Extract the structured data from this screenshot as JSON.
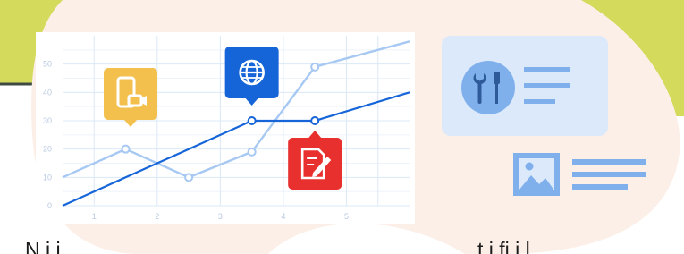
{
  "colors": {
    "bg_green": "#d4da5b",
    "bg_line": "#3f4b42",
    "blob_pink": "#fcefe8",
    "line_dark": "#1565d8",
    "line_light": "#a6c8f2",
    "grid": "#dce8f7",
    "icon_yellow": "#f3c04d",
    "icon_blue": "#1565d8",
    "icon_red": "#e8312f",
    "card_bg": "#dbe9fb",
    "card_accent": "#7fb0ec"
  },
  "icons": {
    "marker_mobile": "mobile-video-icon",
    "marker_globe": "globe-icon",
    "marker_edit": "edit-document-icon",
    "card_tools": "tools-icon",
    "card_image": "image-icon"
  },
  "chart_data": {
    "type": "line",
    "xlim": [
      0,
      5.5
    ],
    "ylim": [
      0,
      60
    ],
    "x_ticks": [
      "1",
      "2",
      "3",
      "4",
      "5"
    ],
    "y_ticks": [
      "0",
      "10",
      "20",
      "30",
      "40",
      "50"
    ],
    "grid": true,
    "series": [
      {
        "style": "light",
        "x": [
          0,
          1,
          2,
          3,
          4,
          5.5
        ],
        "y": [
          10,
          20,
          10,
          19,
          49,
          58
        ],
        "markers_at": [
          1,
          2,
          3,
          4
        ]
      },
      {
        "style": "dark",
        "x": [
          0,
          1,
          2,
          3,
          4,
          5.5
        ],
        "y": [
          0,
          10,
          20,
          30,
          30,
          40
        ],
        "markers_at": [
          3,
          4
        ]
      }
    ]
  },
  "bottom_text": {
    "left_fragment": "N i i",
    "right_fragment": "t i fi i l"
  }
}
